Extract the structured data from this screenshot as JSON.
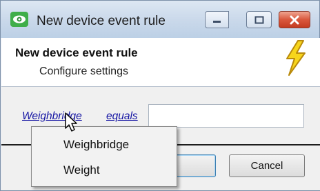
{
  "window": {
    "title": "New device event rule",
    "controls": {
      "minimize": "minimize",
      "maximize": "maximize",
      "close": "close"
    }
  },
  "header": {
    "title": "New device event rule",
    "subtitle": "Configure settings",
    "icon": "lightning-bolt-icon"
  },
  "rule": {
    "field_link": "Weighbridge",
    "operator_link": "equals",
    "value": ""
  },
  "buttons": {
    "ok_label": "",
    "cancel_label": "Cancel"
  },
  "dropdown": {
    "items": [
      "Weighbridge",
      "Weight"
    ]
  },
  "colors": {
    "link": "#1515a3",
    "titlebar": "#c9d8ea",
    "close_button": "#d9573c"
  }
}
